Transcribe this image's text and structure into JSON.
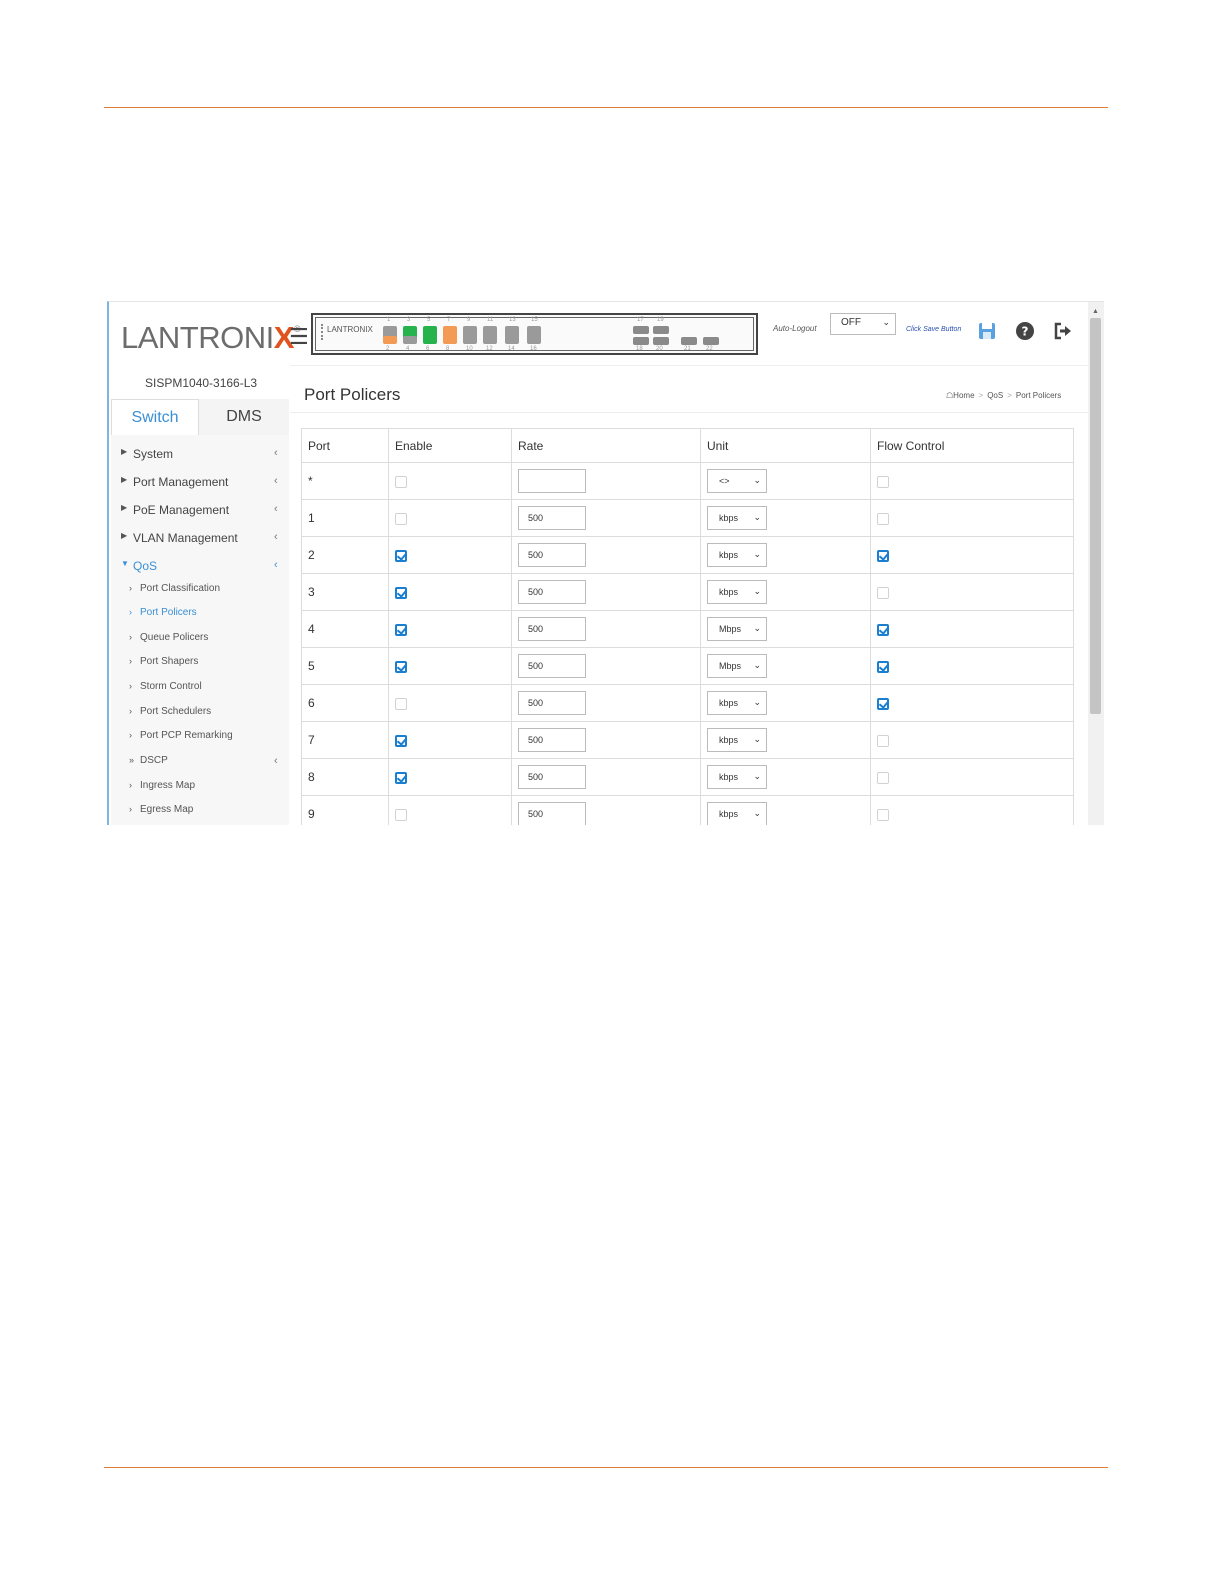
{
  "app": {
    "brand": "LANTRONIX",
    "brand_mark": "®",
    "model": "SISPM1040-3166-L3"
  },
  "device_panel": {
    "logo": "LANTRONIX",
    "top_numbers": [
      "1",
      "3",
      "5",
      "7",
      "9",
      "11",
      "13",
      "15",
      "17",
      "19"
    ],
    "bottom_numbers": [
      "2",
      "4",
      "6",
      "8",
      "10",
      "12",
      "14",
      "16",
      "18",
      "20",
      "21",
      "22"
    ]
  },
  "header": {
    "auto_logout_label": "Auto-Logout",
    "auto_logout_value": "OFF",
    "save_hint": "Click Save Button",
    "icons": [
      "save-icon",
      "help-icon",
      "logout-icon"
    ]
  },
  "tabs": [
    {
      "label": "Switch",
      "active": true
    },
    {
      "label": "DMS",
      "active": false
    }
  ],
  "sidebar": {
    "items": [
      {
        "label": "System"
      },
      {
        "label": "Port Management"
      },
      {
        "label": "PoE Management"
      },
      {
        "label": "VLAN Management"
      },
      {
        "label": "QoS"
      }
    ],
    "qos_subitems": [
      {
        "label": "Port Classification"
      },
      {
        "label": "Port Policers"
      },
      {
        "label": "Queue Policers"
      },
      {
        "label": "Port Shapers"
      },
      {
        "label": "Storm Control"
      },
      {
        "label": "Port Schedulers"
      },
      {
        "label": "Port PCP Remarking"
      },
      {
        "label": "DSCP"
      },
      {
        "label": "Ingress Map"
      },
      {
        "label": "Egress Map"
      }
    ]
  },
  "page": {
    "title": "Port Policers",
    "breadcrumb": [
      "Home",
      "QoS",
      "Port Policers"
    ]
  },
  "table": {
    "headers": [
      "Port",
      "Enable",
      "Rate",
      "Unit",
      "Flow Control"
    ],
    "rows": [
      {
        "port": "*",
        "enable": false,
        "rate": "",
        "unit": "<>",
        "flow": false
      },
      {
        "port": "1",
        "enable": false,
        "rate": "500",
        "unit": "kbps",
        "flow": false
      },
      {
        "port": "2",
        "enable": true,
        "rate": "500",
        "unit": "kbps",
        "flow": true
      },
      {
        "port": "3",
        "enable": true,
        "rate": "500",
        "unit": "kbps",
        "flow": false
      },
      {
        "port": "4",
        "enable": true,
        "rate": "500",
        "unit": "Mbps",
        "flow": true
      },
      {
        "port": "5",
        "enable": true,
        "rate": "500",
        "unit": "Mbps",
        "flow": true
      },
      {
        "port": "6",
        "enable": false,
        "rate": "500",
        "unit": "kbps",
        "flow": true
      },
      {
        "port": "7",
        "enable": true,
        "rate": "500",
        "unit": "kbps",
        "flow": false
      },
      {
        "port": "8",
        "enable": true,
        "rate": "500",
        "unit": "kbps",
        "flow": false
      },
      {
        "port": "9",
        "enable": false,
        "rate": "500",
        "unit": "kbps",
        "flow": false
      }
    ]
  },
  "colors": {
    "accent": "#3a8fd6",
    "rule": "#e07b39",
    "brand_x": "#e0531f",
    "port_green": "#27b34b",
    "port_orange": "#f39a55"
  }
}
